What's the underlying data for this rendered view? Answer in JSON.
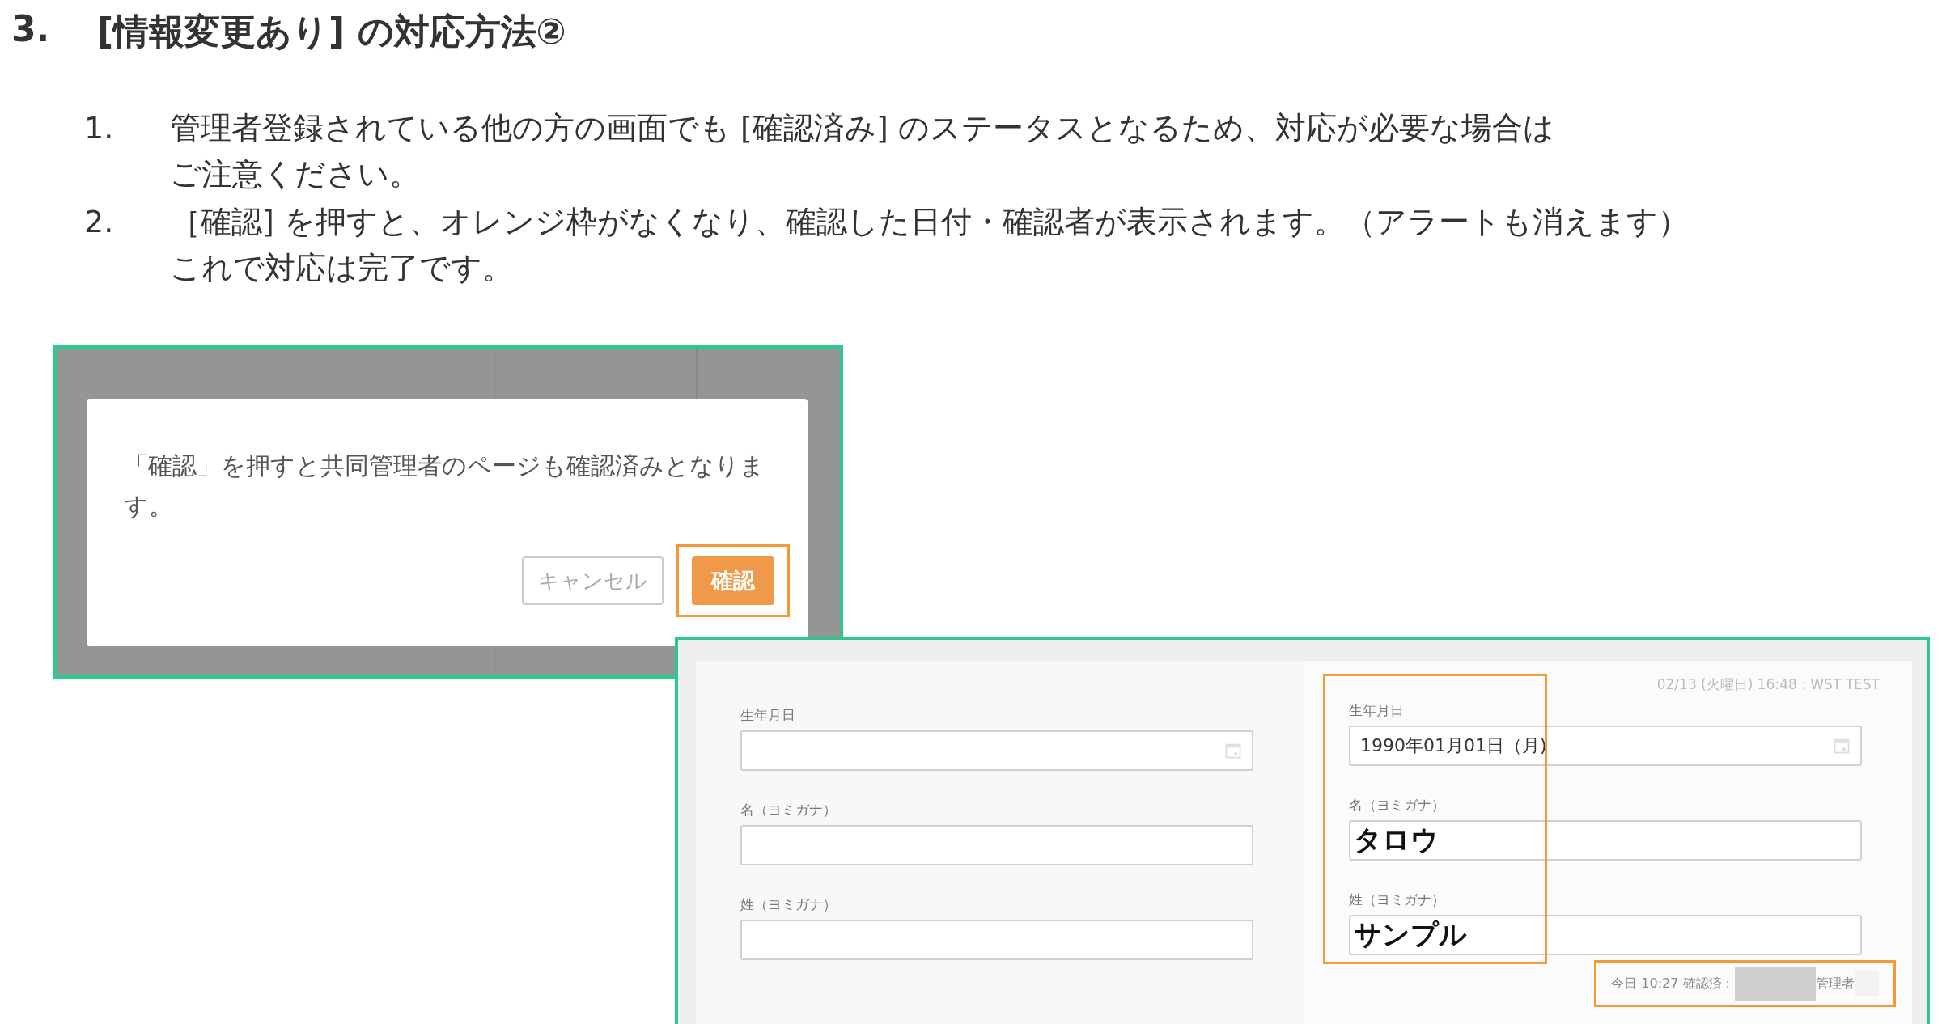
{
  "heading": {
    "number": "3.",
    "text": "[情報変更あり] の対応方法②"
  },
  "steps": [
    {
      "number": "1.",
      "lines": [
        "管理者登録されている他の方の画面でも [確認済み] のステータスとなるため、対応が必要な場合は",
        "ご注意ください。"
      ]
    },
    {
      "number": "2.",
      "lines": [
        "［確認] を押すと、オレンジ枠がなくなり、確認した日付・確認者が表示されます。（アラートも消えます）",
        "これで対応は完了です。"
      ]
    }
  ],
  "dialog_screenshot": {
    "message_lines": [
      "「確認」を押すと共同管理者のページも確認済みとなりま",
      "す。"
    ],
    "buttons": [
      {
        "label": "キャンセル",
        "kind": "secondary",
        "highlighted": false
      },
      {
        "label": "確認",
        "kind": "primary",
        "highlighted": true
      }
    ]
  },
  "form_screenshot": {
    "panels": [
      {
        "highlighted": false,
        "fields": [
          {
            "label": "生年月日",
            "kind": "date"
          },
          {
            "label": "名（ヨミガナ）",
            "kind": "text"
          },
          {
            "label": "姓（ヨミガナ）",
            "kind": "text"
          }
        ]
      },
      {
        "highlighted": true,
        "timestamp": "02/13 (火曜日) 16:48 : WST TEST",
        "fields": [
          {
            "label": "生年月日",
            "kind": "date",
            "value": "1990年01月01日（月)",
            "emphasized": false
          },
          {
            "label": "名（ヨミガナ）",
            "kind": "text",
            "value": "タロウ",
            "emphasized": true
          },
          {
            "label": "姓（ヨミガナ）",
            "kind": "text",
            "value": "サンプル",
            "emphasized": true
          }
        ],
        "confirmation": {
          "text": "今日 10:27 確認済 :",
          "role": "管理者",
          "highlighted": true
        }
      }
    ]
  }
}
